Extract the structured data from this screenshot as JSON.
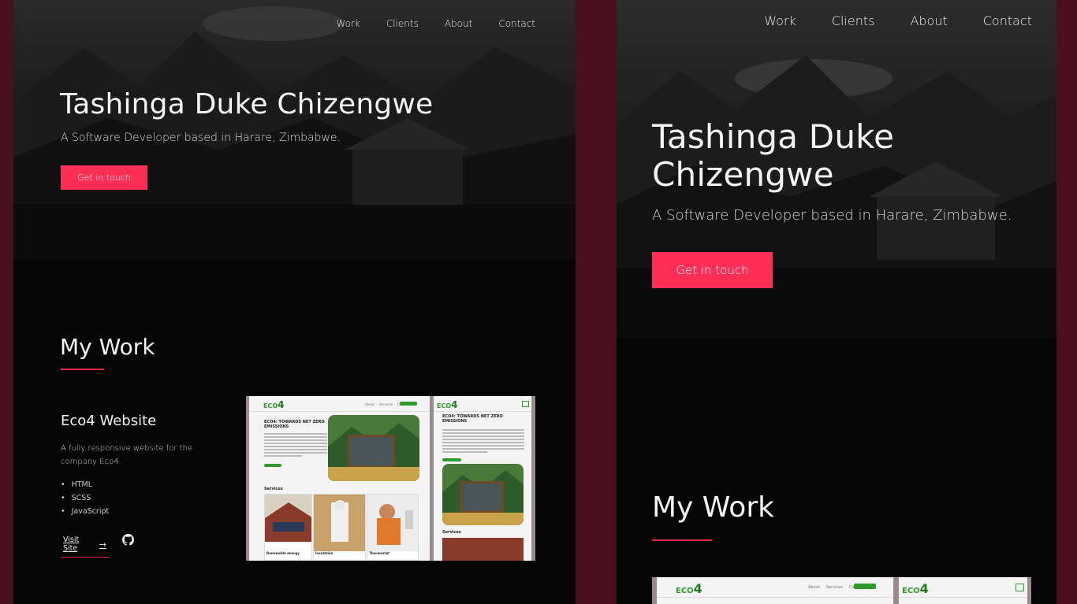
{
  "left": {
    "nav": [
      "Work",
      "Clients",
      "About",
      "Contact"
    ],
    "hero": {
      "title": "Tashinga Duke Chizengwe",
      "subtitle": "A Software Developer based in Harare, Zimbabwe.",
      "cta": "Get in touch"
    },
    "work": {
      "title": "My Work",
      "project": {
        "title": "Eco4 Website",
        "description": "A fully responsive website for the company Eco4.",
        "tech": [
          "HTML",
          "SCSS",
          "JavaScript"
        ],
        "visit_label": "Visit Site",
        "arrow": "→"
      }
    }
  },
  "right": {
    "nav": [
      "Work",
      "Clients",
      "About",
      "Contact"
    ],
    "hero": {
      "title": "Tashinga Duke Chizengwe",
      "subtitle": "A Software Developer based in Harare, Zimbabwe.",
      "cta": "Get in touch"
    },
    "work": {
      "title": "My Work"
    }
  },
  "mockup": {
    "logo_prefix": "ECO",
    "logo_digit": "4",
    "nav": [
      "About",
      "Services",
      "Contact"
    ],
    "heading": "ECO4: TOWARDS NET ZERO EMISSIONS",
    "services_label": "Services",
    "cards": [
      "Renewable energy",
      "Insulation",
      "Thermostat"
    ]
  },
  "colors": {
    "accent": "#ff2e56",
    "underline": "#e8293f",
    "frame": "#4a1020",
    "panel": "#050505",
    "mock_green": "#2f9a2a"
  }
}
